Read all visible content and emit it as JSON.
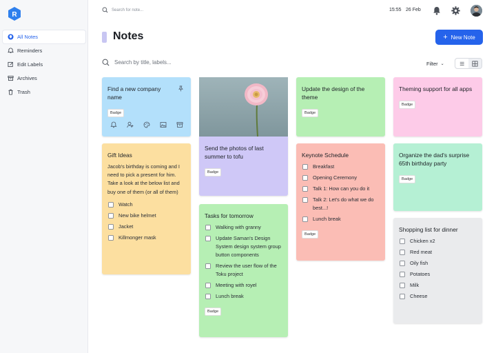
{
  "app": {
    "logo_letter": "R",
    "brand_color": "#2f80ed"
  },
  "sidebar": {
    "items": [
      {
        "label": "All Notes",
        "icon": "lightbulb-icon",
        "active": true
      },
      {
        "label": "Reminders",
        "icon": "bell-icon"
      },
      {
        "label": "Edit Labels",
        "icon": "edit-icon"
      },
      {
        "label": "Archives",
        "icon": "archive-icon"
      },
      {
        "label": "Trash",
        "icon": "trash-icon"
      }
    ]
  },
  "topbar": {
    "search_placeholder": "Search for note...",
    "time": "15:55",
    "date": "26 Feb"
  },
  "header": {
    "title": "Notes",
    "new_note_label": "New Note",
    "search_placeholder": "Search by title, labels...",
    "filter_label": "Filter"
  },
  "notes": {
    "n1": {
      "title": "Find a new company name",
      "badge": "Badge",
      "color": "#b3e0fb"
    },
    "n2": {
      "title": "Gift Ideas",
      "body": "Jacob's birthday is coming and I need to pick a present for him. Take a look at the below list and buy one of them (or all of them)",
      "items": [
        "Watch",
        "New bike helmet",
        "Jacket",
        "Killmonger mask"
      ],
      "color": "#fcdfa0"
    },
    "n3": {
      "title": "Send the photos of last summer to tofu",
      "badge": "Badge",
      "color": "#cfc8f7"
    },
    "n4": {
      "title": "Tasks for tomorrow",
      "items": [
        "Walking with granny",
        "Update Saman's Design System design system group button components",
        "Review the user flow of the Toku project",
        "Meeting with royel",
        "Lunch break"
      ],
      "badge": "Badge",
      "color": "#b6efb4"
    },
    "n5": {
      "title": "Update the design of the theme",
      "badge": "Badge",
      "color": "#b6efb4"
    },
    "n6": {
      "title": "Keynote Schedule",
      "items": [
        "Breakfast",
        "Opening Ceremony",
        "Talk 1: How can you do it",
        "Talk 2: Let's do what we do best...!",
        "Lunch break"
      ],
      "badge": "Badge",
      "color": "#fbbdb5"
    },
    "n7": {
      "title": "Theming support for all apps",
      "badge": "Badge",
      "color": "#fdcbe8"
    },
    "n8": {
      "title": "Organize the dad's surprise 65th birthday party",
      "badge": "Badge",
      "color": "#b5f0d4"
    },
    "n9": {
      "title": "Shopping list for dinner",
      "items": [
        "Chicken x2",
        "Red meat",
        "Oily fish",
        "Potatoes",
        "Milk",
        "Cheese"
      ],
      "color": "#eaebed"
    }
  }
}
